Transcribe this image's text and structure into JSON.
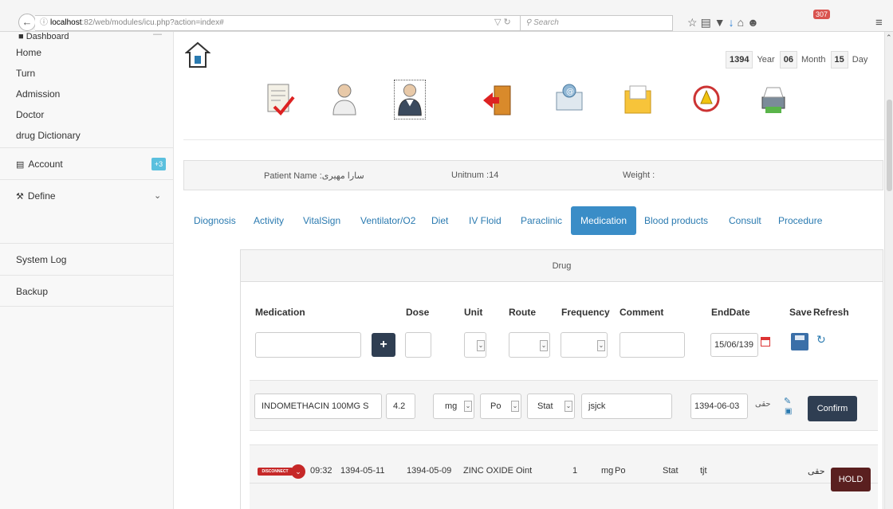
{
  "browser": {
    "url_host": "localhost",
    "url_path": ":82/web/modules/icu.php?action=index#",
    "search_placeholder": "Search",
    "badge_count": "307"
  },
  "sidebar": {
    "header": "Dashboard",
    "links": [
      "Home",
      "Turn",
      "Admission",
      "Doctor",
      "drug Dictionary"
    ],
    "sections": [
      {
        "label": "Account",
        "badge": "+3"
      },
      {
        "label": "Define"
      },
      {
        "label": "System Log"
      },
      {
        "label": "Backup"
      }
    ]
  },
  "date": {
    "year": "1394",
    "year_label": "Year",
    "month": "06",
    "month_label": "Month",
    "day": "15",
    "day_label": "Day"
  },
  "toolbar_icons": [
    "clipboard-check-icon",
    "nurse-icon",
    "doctor-icon",
    "exit-door-icon",
    "email-icon",
    "folder-icon",
    "alarm-clock-icon",
    "printer-icon"
  ],
  "patient": {
    "name": "Patient Name :سارا مهیری",
    "unit": "Unitnum :14",
    "weight": "Weight :"
  },
  "tabs": [
    "Diognosis",
    "Activity",
    "VitalSign",
    "Ventilator/O2",
    "Diet",
    "IV Floid",
    "Paraclinic",
    "Medication",
    "Blood products",
    "Consult",
    "Procedure"
  ],
  "active_tab": "Medication",
  "panel": {
    "title": "Drug"
  },
  "form": {
    "headers": {
      "medication": "Medication",
      "dose": "Dose",
      "unit": "Unit",
      "route": "Route",
      "frequency": "Frequency",
      "comment": "Comment",
      "enddate": "EndDate",
      "save": "Save",
      "refresh": "Refresh"
    },
    "plus": "+",
    "enddate_value": "15/06/139"
  },
  "pending_row": {
    "medication": "INDOMETHACIN 100MG S",
    "dose": "4.2",
    "unit": "mg",
    "route": "Po",
    "frequency": "Stat",
    "comment": "jsjck",
    "enddate": "1394-06-03",
    "sign": "حقی",
    "confirm": "Confirm"
  },
  "record": {
    "disconnect": "DISCONNECT",
    "time": "09:32",
    "date1": "1394-05-11",
    "date2": "1394-05-09",
    "drug": "ZINC OXIDE Oint",
    "dose": "1",
    "unit": "mg",
    "route": "Po",
    "frequency": "Stat",
    "comment": "tjt",
    "sign": "حقی",
    "hold": "HOLD"
  }
}
